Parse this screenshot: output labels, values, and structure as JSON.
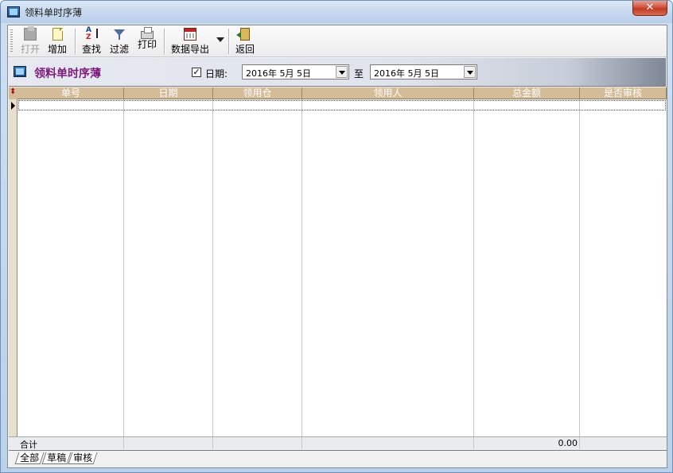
{
  "window": {
    "title": "领料单时序薄",
    "close_label": "✕"
  },
  "toolbar": {
    "open_label": "打开",
    "add_label": "增加",
    "find_label": "查找",
    "filter_label": "过滤",
    "print_label": "打印",
    "export_label": "数据导出",
    "back_label": "返回"
  },
  "header": {
    "title": "领料单时序薄",
    "date_checkbox_mark": "✓",
    "date_label": "日期:",
    "date_from": "2016年  5月  5日",
    "to_label": "至",
    "date_to": "2016年  5月  5日"
  },
  "grid": {
    "columns": [
      "单号",
      "日期",
      "领用仓",
      "领用人",
      "总金额",
      "是否审核"
    ],
    "total_label": "合计",
    "total_amount": "0.00"
  },
  "tabs": [
    "全部",
    "草稿",
    "审核"
  ],
  "colors": {
    "band_title": "#7d1a7d",
    "grid_header": "#d3bc97"
  }
}
